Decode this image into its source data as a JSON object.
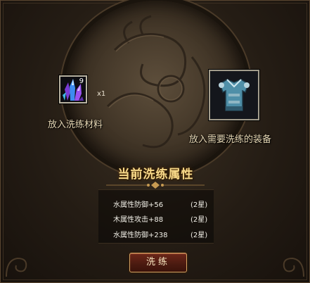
{
  "material_slot": {
    "icon": "crystal-cluster-icon",
    "count": "9",
    "multiplier": "x1",
    "label": "放入洗练材料"
  },
  "equipment_slot": {
    "icon": "armor-icon",
    "label": "放入需要洗练的装备"
  },
  "attributes": {
    "title": "当前洗练属性",
    "rows": [
      {
        "name": "水属性防御+56",
        "stars": "(2星)"
      },
      {
        "name": "木属性攻击+88",
        "stars": "(2星)"
      },
      {
        "name": "水属性防御+238",
        "stars": "(2星)"
      }
    ]
  },
  "action_button": {
    "label": "洗练"
  },
  "colors": {
    "title_gold": "#f7d98a",
    "label_tan": "#e6d7b4",
    "button_red": "#6d2719",
    "button_border": "#d5a461"
  }
}
